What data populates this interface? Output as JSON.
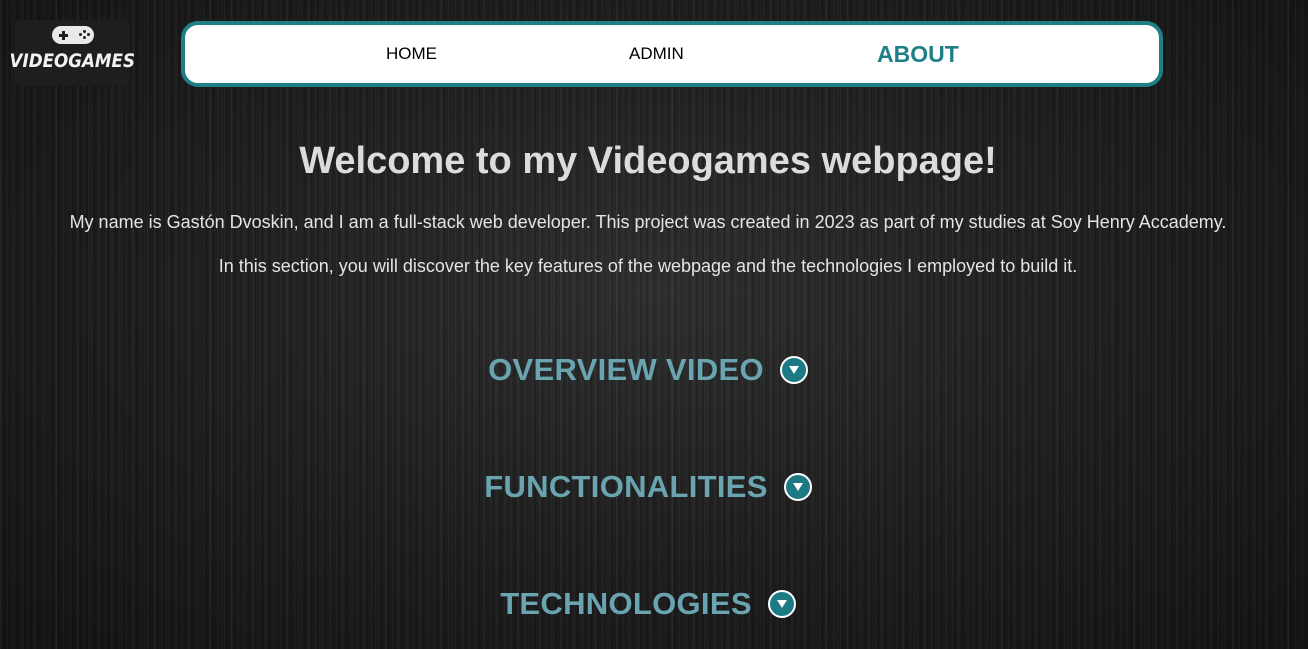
{
  "logo": {
    "text": "VIDEOGAMES",
    "icon": "gamepad-icon"
  },
  "nav": {
    "items": [
      {
        "label": "HOME",
        "active": false
      },
      {
        "label": "ADMIN",
        "active": false
      },
      {
        "label": "ABOUT",
        "active": true
      }
    ]
  },
  "main": {
    "title": "Welcome to my Videogames webpage!",
    "intro_1": "My name is Gastón Dvoskin, and I am a full-stack web developer. This project was created in 2023 as part of my studies at Soy Henry Accademy.",
    "intro_2": "In this section, you will discover the key features of the webpage and the technologies I employed to build it."
  },
  "sections": [
    {
      "title": "OVERVIEW VIDEO",
      "icon": "chevron-down-icon",
      "expanded": false
    },
    {
      "title": "FUNCTIONALITIES",
      "icon": "chevron-down-icon",
      "expanded": false
    },
    {
      "title": "TECHNOLOGIES",
      "icon": "chevron-down-icon",
      "expanded": false
    }
  ],
  "colors": {
    "accent": "#1f7f87",
    "section_title": "#6aa4b0",
    "heading_text": "#dcdcdc",
    "background": "#1a1a1a"
  }
}
